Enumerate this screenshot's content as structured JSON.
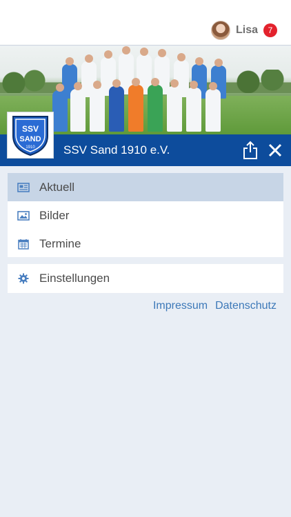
{
  "header": {
    "username": "Lisa",
    "notification_count": "7"
  },
  "club": {
    "name": "SSV Sand 1910 e.V.",
    "logo_text_line1": "SSV",
    "logo_text_line2": "SAND",
    "logo_year": "1910"
  },
  "menu": {
    "items": [
      {
        "label": "Aktuell",
        "icon": "newspaper-icon",
        "active": true
      },
      {
        "label": "Bilder",
        "icon": "image-icon",
        "active": false
      },
      {
        "label": "Termine",
        "icon": "calendar-icon",
        "active": false
      }
    ],
    "settings": {
      "label": "Einstellungen",
      "icon": "gear-icon"
    }
  },
  "footer_links": {
    "impressum": "Impressum",
    "datenschutz": "Datenschutz"
  },
  "colors": {
    "club_blue": "#0d4c9c",
    "active_row": "#c7d5e6",
    "link": "#3c78b8",
    "badge_red": "#e3222d",
    "icon_blue": "#4a7fc0"
  }
}
